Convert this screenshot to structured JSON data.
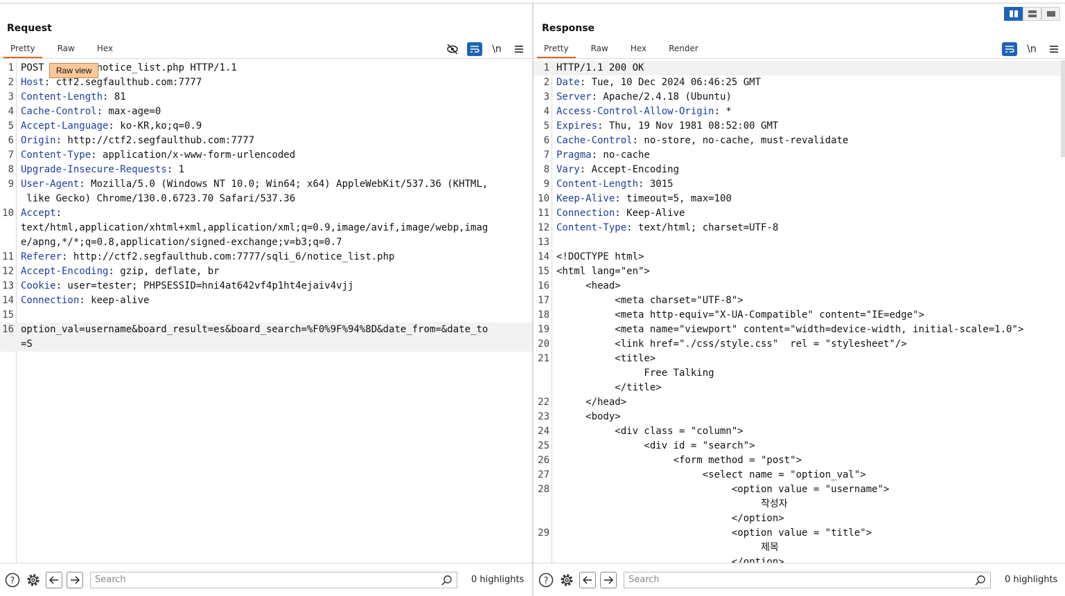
{
  "request": {
    "title": "Request",
    "tabs": [
      "Pretty",
      "Raw",
      "Hex"
    ],
    "active_tab": "Pretty",
    "tooltip": "Raw view",
    "newline_label": "\\n",
    "search_placeholder": "Search",
    "highlights": "0 highlights",
    "lines": [
      {
        "n": "1",
        "key": "",
        "val": "POST /sqli_6/notice_list.php HTTP/1.1"
      },
      {
        "n": "2",
        "key": "Host",
        "val": " ctf2.segfaulthub.com:7777"
      },
      {
        "n": "3",
        "key": "Content-Length",
        "val": " 81"
      },
      {
        "n": "4",
        "key": "Cache-Control",
        "val": " max-age=0"
      },
      {
        "n": "5",
        "key": "Accept-Language",
        "val": " ko-KR,ko;q=0.9"
      },
      {
        "n": "6",
        "key": "Origin",
        "val": " http://ctf2.segfaulthub.com:7777"
      },
      {
        "n": "7",
        "key": "Content-Type",
        "val": " application/x-www-form-urlencoded"
      },
      {
        "n": "8",
        "key": "Upgrade-Insecure-Requests",
        "val": " 1"
      },
      {
        "n": "9",
        "key": "User-Agent",
        "val": " Mozilla/5.0 (Windows NT 10.0; Win64; x64) AppleWebKit/537.36 (KHTML,"
      },
      {
        "n": "",
        "key": "",
        "val": " like Gecko) Chrome/130.0.6723.70 Safari/537.36"
      },
      {
        "n": "10",
        "key": "Accept",
        "val": ""
      },
      {
        "n": "",
        "key": "",
        "val": "text/html,application/xhtml+xml,application/xml;q=0.9,image/avif,image/webp,imag"
      },
      {
        "n": "",
        "key": "",
        "val": "e/apng,*/*;q=0.8,application/signed-exchange;v=b3;q=0.7"
      },
      {
        "n": "11",
        "key": "Referer",
        "val": " http://ctf2.segfaulthub.com:7777/sqli_6/notice_list.php"
      },
      {
        "n": "12",
        "key": "Accept-Encoding",
        "val": " gzip, deflate, br"
      },
      {
        "n": "13",
        "key": "Cookie",
        "val": " user=tester; PHPSESSID=hni4at642vf4p1ht4ejaiv4vjj"
      },
      {
        "n": "14",
        "key": "Connection",
        "val": " keep-alive"
      },
      {
        "n": "15",
        "key": "",
        "val": ""
      },
      {
        "n": "16",
        "key": "",
        "val": "option_val=username&board_result=es&board_search=%F0%9F%94%8D&date_from=&date_to"
      },
      {
        "n": "",
        "key": "",
        "val": "=S"
      }
    ]
  },
  "response": {
    "title": "Response",
    "tabs": [
      "Pretty",
      "Raw",
      "Hex",
      "Render"
    ],
    "active_tab": "Pretty",
    "newline_label": "\\n",
    "search_placeholder": "Search",
    "highlights": "0 highlights",
    "lines": [
      {
        "n": "1",
        "key": "",
        "val": "HTTP/1.1 200 OK"
      },
      {
        "n": "2",
        "key": "Date",
        "val": " Tue, 10 Dec 2024 06:46:25 GMT"
      },
      {
        "n": "3",
        "key": "Server",
        "val": " Apache/2.4.18 (Ubuntu)"
      },
      {
        "n": "4",
        "key": "Access-Control-Allow-Origin",
        "val": " *"
      },
      {
        "n": "5",
        "key": "Expires",
        "val": " Thu, 19 Nov 1981 08:52:00 GMT"
      },
      {
        "n": "6",
        "key": "Cache-Control",
        "val": " no-store, no-cache, must-revalidate"
      },
      {
        "n": "7",
        "key": "Pragma",
        "val": " no-cache"
      },
      {
        "n": "8",
        "key": "Vary",
        "val": " Accept-Encoding"
      },
      {
        "n": "9",
        "key": "Content-Length",
        "val": " 3015"
      },
      {
        "n": "10",
        "key": "Keep-Alive",
        "val": " timeout=5, max=100"
      },
      {
        "n": "11",
        "key": "Connection",
        "val": " Keep-Alive"
      },
      {
        "n": "12",
        "key": "Content-Type",
        "val": " text/html; charset=UTF-8"
      },
      {
        "n": "13",
        "key": "",
        "val": ""
      },
      {
        "n": "14",
        "key": "",
        "val": "<!DOCTYPE html>"
      },
      {
        "n": "15",
        "key": "",
        "val": "<html lang=\"en\">"
      },
      {
        "n": "16",
        "key": "",
        "val": "     <head>"
      },
      {
        "n": "17",
        "key": "",
        "val": "          <meta charset=\"UTF-8\">"
      },
      {
        "n": "18",
        "key": "",
        "val": "          <meta http-equiv=\"X-UA-Compatible\" content=\"IE=edge\">"
      },
      {
        "n": "19",
        "key": "",
        "val": "          <meta name=\"viewport\" content=\"width=device-width, initial-scale=1.0\">"
      },
      {
        "n": "20",
        "key": "",
        "val": "          <link href=\"./css/style.css\"  rel = \"stylesheet\"/>"
      },
      {
        "n": "21",
        "key": "",
        "val": "          <title>"
      },
      {
        "n": "",
        "key": "",
        "val": "               Free Talking"
      },
      {
        "n": "",
        "key": "",
        "val": "          </title>"
      },
      {
        "n": "22",
        "key": "",
        "val": "     </head>"
      },
      {
        "n": "23",
        "key": "",
        "val": "     <body>"
      },
      {
        "n": "24",
        "key": "",
        "val": "          <div class = \"column\">"
      },
      {
        "n": "25",
        "key": "",
        "val": "               <div id = \"search\">"
      },
      {
        "n": "26",
        "key": "",
        "val": "                    <form method = \"post\">"
      },
      {
        "n": "27",
        "key": "",
        "val": "                         <select name = \"option_val\">"
      },
      {
        "n": "28",
        "key": "",
        "val": "                              <option value = \"username\">"
      },
      {
        "n": "",
        "key": "",
        "val": "                                   작성자"
      },
      {
        "n": "",
        "key": "",
        "val": "                              </option>"
      },
      {
        "n": "29",
        "key": "",
        "val": "                              <option value = \"title\">"
      },
      {
        "n": "",
        "key": "",
        "val": "                                   제목"
      },
      {
        "n": "",
        "key": "",
        "val": "                              </option>"
      }
    ]
  }
}
